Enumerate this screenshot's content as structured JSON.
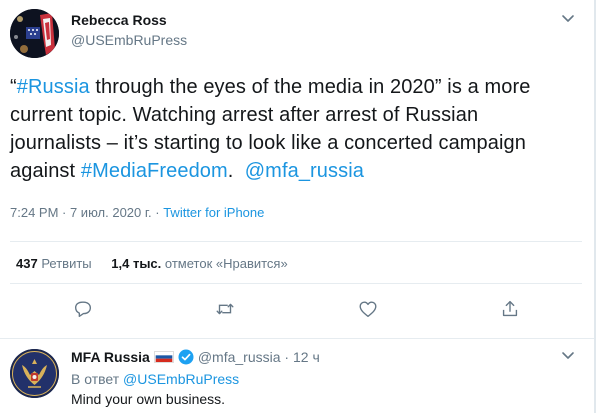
{
  "tweet": {
    "author_name": "Rebecca Ross",
    "author_handle": "@USEmbRuPress",
    "body": {
      "q_open": "“",
      "hashtag_russia": "#Russia",
      "part1": " through the eyes of the media in 2020” is a more current topic.  Watching arrest after arrest of Russian journalists – it’s starting to look like a concerted campaign against ",
      "hashtag_mediafreedom": "#MediaFreedom",
      "part2": ".  ",
      "mention": "@mfa_russia"
    },
    "timestamp": "7:24 PM · 7 июл. 2020 г. · ",
    "source": "Twitter for iPhone",
    "retweets_count": "437",
    "retweets_label": "Ретвиты",
    "likes_count": "1,4 тыс.",
    "likes_label": "отметок «Нравится»"
  },
  "reply": {
    "author_name": "MFA Russia",
    "author_handle": "@mfa_russia",
    "separator": " · ",
    "age": "12 ч",
    "in_reply_prefix": "В ответ ",
    "in_reply_handle": "@USEmbRuPress",
    "text": "Mind your own business."
  },
  "icons": {
    "caret": "chevron-down-icon",
    "reply": "comment-icon",
    "retweet": "retweet-icon",
    "like": "heart-icon",
    "share": "share-icon",
    "verified": "verified-badge-icon",
    "flag": "russia-flag-icon"
  },
  "colors": {
    "link": "#1b95e0",
    "secondary_text": "#657786",
    "primary_text": "#14171a",
    "divider": "#e6ecf0"
  }
}
